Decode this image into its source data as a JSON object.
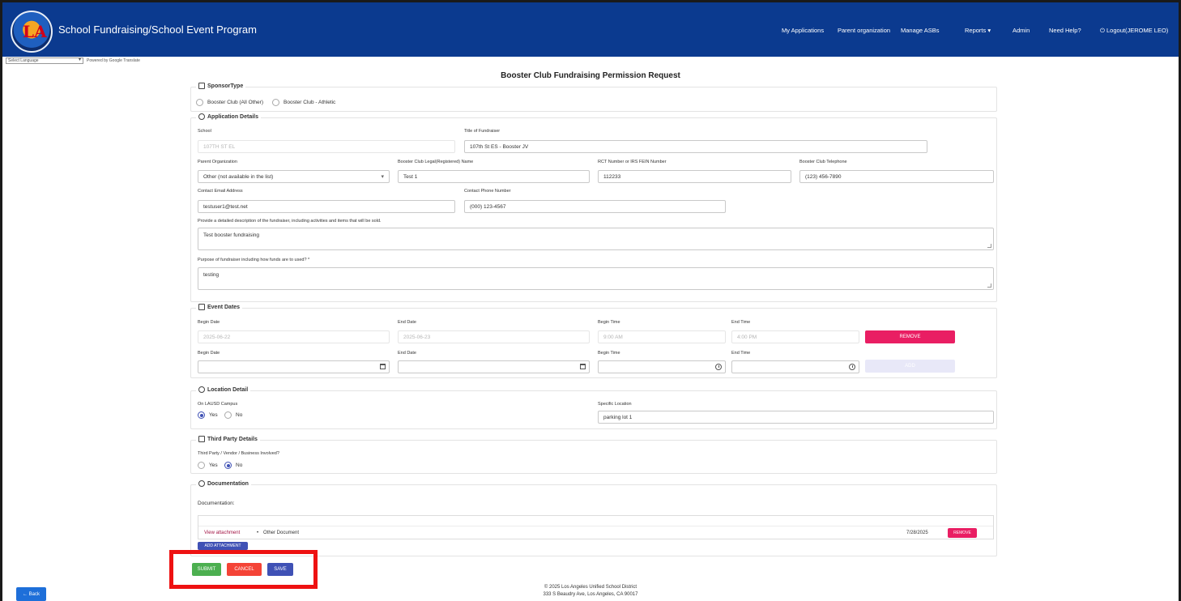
{
  "header": {
    "app_title": "School Fundraising/School Event Program",
    "nav": [
      "My Applications",
      "Parent organization",
      "Manage ASBs",
      "Reports ▾",
      "Admin",
      "Need Help?",
      "⏻ Logout(JEROME LEO)"
    ]
  },
  "language": {
    "select_label": "Select Language",
    "powered": "Powered by Google Translate"
  },
  "page_title": "Booster Club Fundraising Permission Request",
  "sponsor": {
    "legend": "SponsorType",
    "options": [
      "Booster Club (All Other)",
      "Booster Club - Athletic"
    ]
  },
  "application": {
    "legend": "Application Details",
    "school_label": "School",
    "school_value": "107TH ST EL",
    "title_label": "Title of Fundraiser",
    "title_value": "107th St ES - Booster JV",
    "parent_org_label": "Parent Organization",
    "parent_org_value": "Other (not available in the list)",
    "legal_name_label": "Booster Club Legal(Registered) Name",
    "legal_name_value": "Test 1",
    "rct_label": "RCT Number or IRS FEIN Number",
    "rct_value": "112233",
    "phone_label": "Booster Club Telephone",
    "phone_value": "(123) 456-7890",
    "email_label": "Contact Email Address",
    "email_value": "testuser1@test.net",
    "contact_phone_label": "Contact Phone Number",
    "contact_phone_value": "(000) 123-4567",
    "description_label": "Provide a detailed description of the fundraiser, including activities and items that will be sold.",
    "description_value": "Test booster fundraising",
    "purpose_label": "Purpose of fundraiser including how funds are to used? *",
    "purpose_value": "testing"
  },
  "event_dates": {
    "legend": "Event Dates",
    "begin_date_label": "Begin Date",
    "end_date_label": "End Date",
    "begin_time_label": "Begin Time",
    "end_time_label": "End Time",
    "row1": {
      "begin_date": "2025-06-22",
      "end_date": "2025-06-23",
      "begin_time": "9:00 AM",
      "end_time": "4:00 PM"
    },
    "remove_label": "REMOVE",
    "add_label": "ADD"
  },
  "location": {
    "legend": "Location Detail",
    "campus_label": "On LAUSD Campus",
    "yes": "Yes",
    "no": "No",
    "specific_label": "Specific Location",
    "specific_value": "parking lot 1"
  },
  "third_party": {
    "legend": "Third Party Details",
    "question": "Third Party / Vendor / Business Involved?",
    "yes": "Yes",
    "no": "No"
  },
  "documentation": {
    "legend": "Documentation",
    "label": "Documentation:",
    "view_link": "View attachment",
    "doc_type": "Other Document",
    "date": "7/28/2025",
    "remove_label": "REMOVE",
    "add_attachment_label": "ADD ATTACHMENT"
  },
  "actions": {
    "submit": "SUBMIT",
    "cancel": "CANCEL",
    "save": "SAVE"
  },
  "footer": {
    "line1": "© 2025 Los Angeles Unified School District",
    "line2": "333 S Beaudry Ave, Los Angeles, CA 90017"
  },
  "back_label": "← Back",
  "colors": {
    "header": "#0b3a8f",
    "remove": "#e91e63",
    "submit": "#4caf50",
    "cancel": "#f44336",
    "save": "#3f51b5",
    "add_disabled": "#e8e8f8"
  }
}
